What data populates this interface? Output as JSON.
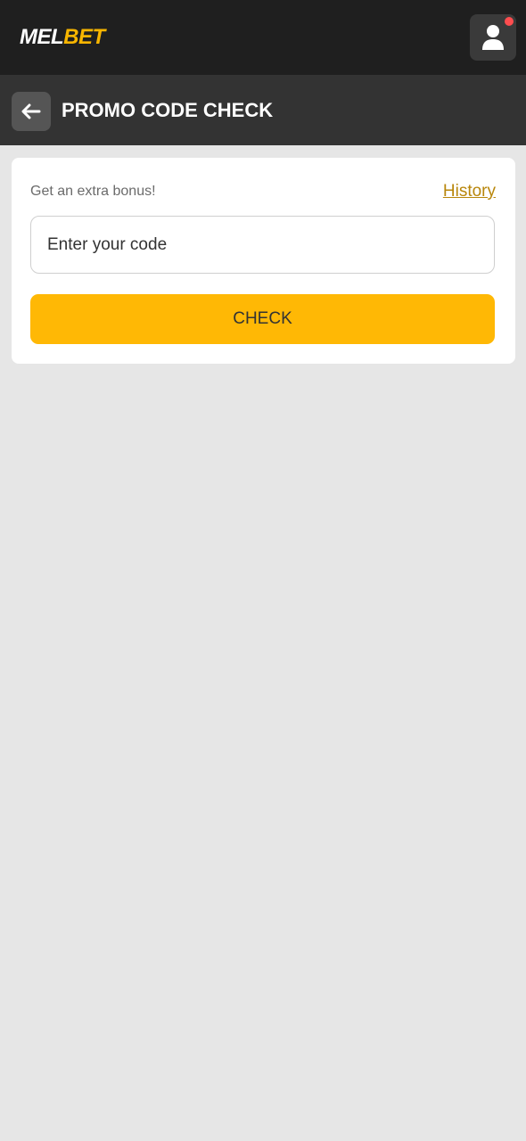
{
  "brand": {
    "logo_part1": "MEL",
    "logo_part2": "BET",
    "accent": "#f7b500"
  },
  "header": {
    "profile_icon": "user-icon",
    "notification_dot_color": "#ff4d4f"
  },
  "page": {
    "back_icon": "arrow-left-icon",
    "title": "PROMO CODE CHECK"
  },
  "promo": {
    "subtitle": "Get an extra bonus!",
    "history_label": "History",
    "history_color": "#b8860b",
    "input_placeholder": "Enter your code",
    "input_value": "",
    "check_label": "CHECK",
    "check_color": "#ffb805"
  }
}
